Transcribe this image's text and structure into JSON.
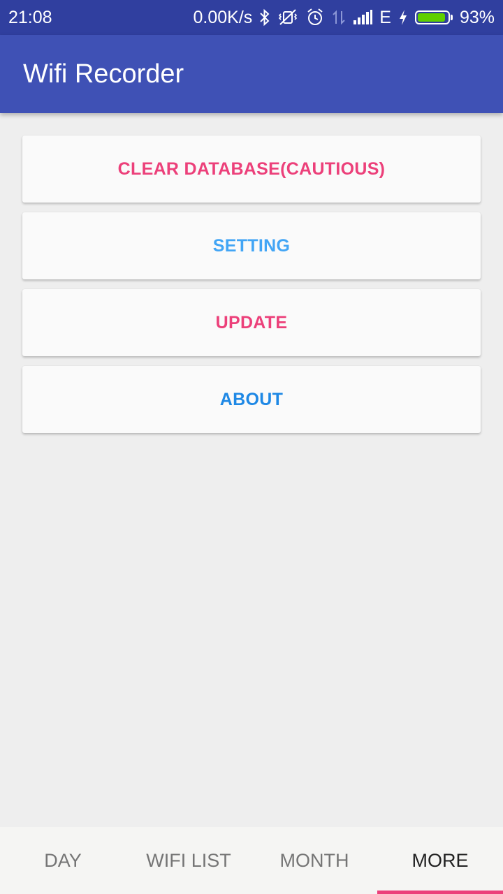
{
  "status_bar": {
    "time": "21:08",
    "net_speed": "0.00K/s",
    "network_type": "E",
    "battery_percent": "93%",
    "battery_level": 0.93,
    "battery_color": "#5fd000",
    "icons": [
      "bluetooth-icon",
      "vibrate-off-icon",
      "alarm-icon",
      "data-arrows-icon",
      "signal-icon",
      "charging-icon",
      "battery-icon"
    ]
  },
  "app_bar": {
    "title": "Wifi Recorder"
  },
  "actions": [
    {
      "label": "CLEAR DATABASE(CAUTIOUS)",
      "color": "#ec407a"
    },
    {
      "label": "SETTING",
      "color": "#42a5f5"
    },
    {
      "label": "UPDATE",
      "color": "#ec407a"
    },
    {
      "label": "ABOUT",
      "color": "#1e88e5"
    }
  ],
  "bottom_nav": {
    "tabs": [
      {
        "label": "DAY",
        "active": false
      },
      {
        "label": "WIFI LIST",
        "active": false
      },
      {
        "label": "MONTH",
        "active": false
      },
      {
        "label": "MORE",
        "active": true
      }
    ],
    "indicator_color": "#ec407a"
  },
  "colors": {
    "status_bar": "#303f9f",
    "app_bar": "#3f51b5",
    "background": "#eeeeee"
  }
}
